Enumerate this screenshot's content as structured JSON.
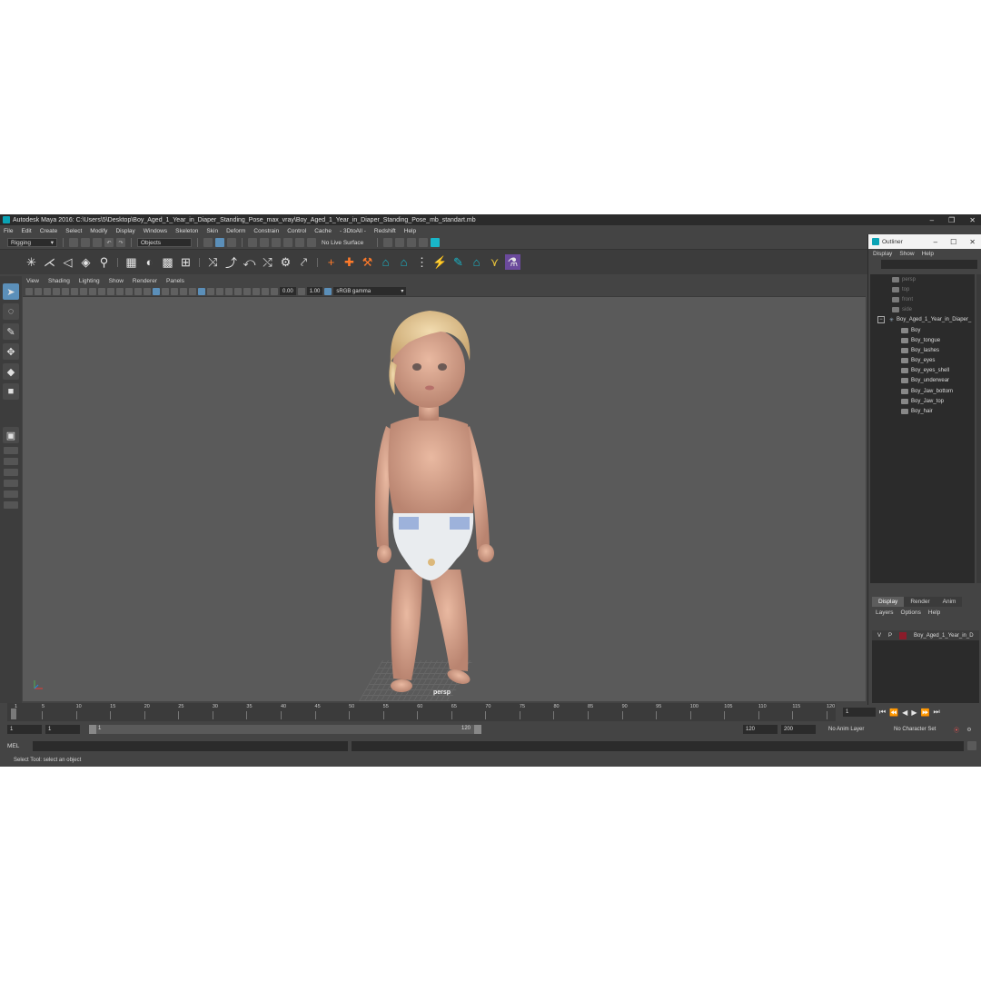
{
  "window": {
    "title": "Autodesk Maya 2016: C:\\Users\\5\\Desktop\\Boy_Aged_1_Year_in_Diaper_Standing_Pose_max_vray\\Boy_Aged_1_Year_in_Diaper_Standing_Pose_mb_standart.mb",
    "minimize": "–",
    "maximize": "❐",
    "close": "✕"
  },
  "menubar": [
    "File",
    "Edit",
    "Create",
    "Select",
    "Modify",
    "Display",
    "Windows",
    "Skeleton",
    "Skin",
    "Deform",
    "Constrain",
    "Control",
    "Cache",
    "- 3DtoAll -",
    "Redshift",
    "Help"
  ],
  "statusline": {
    "menuset": "Rigging",
    "selection_mode": "Objects",
    "live_surface": "No Live Surface"
  },
  "viewport": {
    "menu": [
      "View",
      "Shading",
      "Lighting",
      "Show",
      "Renderer",
      "Panels"
    ],
    "exposure": "0.00",
    "gamma": "1.00",
    "color_space": "sRGB gamma",
    "camera_label": "persp"
  },
  "outliner": {
    "title": "Outliner",
    "menu": [
      "Display",
      "Show",
      "Help"
    ],
    "cameras": [
      "persp",
      "top",
      "front",
      "side"
    ],
    "group": "Boy_Aged_1_Year_in_Diaper_",
    "children": [
      "Boy",
      "Boy_tongue",
      "Boy_lashes",
      "Boy_eyes",
      "Boy_eyes_shell",
      "Boy_underwear",
      "Boy_Jaw_bottom",
      "Boy_Jaw_top",
      "Boy_hair"
    ]
  },
  "layers": {
    "tabs": [
      "Display",
      "Render",
      "Anim"
    ],
    "menu": [
      "Layers",
      "Options",
      "Help"
    ],
    "layer": {
      "v": "V",
      "p": "P",
      "name": "Boy_Aged_1_Year_in_D",
      "color": "#8a1c2a"
    }
  },
  "timeline": {
    "ticks": [
      "1",
      "5",
      "10",
      "15",
      "20",
      "25",
      "30",
      "35",
      "40",
      "45",
      "50",
      "55",
      "60",
      "65",
      "70",
      "75",
      "80",
      "85",
      "90",
      "95",
      "100",
      "105",
      "110",
      "115",
      "120"
    ],
    "current_frame": "1"
  },
  "range": {
    "start": "1",
    "playback_start": "1",
    "slider_start": "1",
    "slider_end": "120",
    "playback_end": "120",
    "end": "200",
    "anim_layer": "No Anim Layer",
    "character_set": "No Character Set"
  },
  "cmdline": {
    "label": "MEL"
  },
  "helpline": "Select Tool: select an object",
  "colors": {
    "ui_bg": "#444444",
    "viewport_bg": "#5a5a5a",
    "accent": "#0aa3b5"
  }
}
